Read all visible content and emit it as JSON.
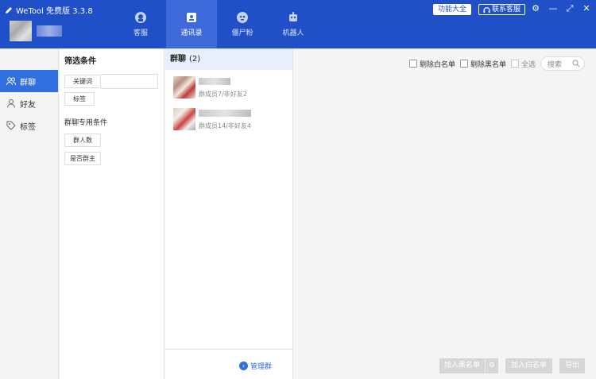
{
  "header": {
    "app_title": "WeTool 免费版 3.3.8",
    "nav": [
      {
        "label": "客服",
        "icon": "headset-icon",
        "active": false
      },
      {
        "label": "通讯录",
        "icon": "contacts-icon",
        "active": true
      },
      {
        "label": "僵尸粉",
        "icon": "zombie-icon",
        "active": false
      },
      {
        "label": "机器人",
        "icon": "robot-icon",
        "active": false
      }
    ],
    "features_label": "功能大全",
    "contact_label": "联系客服",
    "colors": {
      "primary": "#1f50c8",
      "active_tab": "#3e6ad9"
    }
  },
  "sidebar": {
    "items": [
      {
        "label": "群聊",
        "icon": "group-icon",
        "active": true
      },
      {
        "label": "好友",
        "icon": "person-icon",
        "active": false
      },
      {
        "label": "标签",
        "icon": "tag-icon",
        "active": false
      }
    ]
  },
  "filter": {
    "title": "筛选条件",
    "keyword_label": "关键词",
    "tag_label": "标签",
    "group_section_title": "群聊专用条件",
    "member_count_label": "群人数",
    "is_owner_label": "是否群主"
  },
  "group_list": {
    "title": "群聊",
    "count": "(2)",
    "items": [
      {
        "meta": "群成员7/非好友2"
      },
      {
        "meta": "群成员14/非好友4"
      }
    ],
    "manage_label": "管理群"
  },
  "right_panel": {
    "remove_whitelist": "剔除白名单",
    "remove_blacklist": "剔除黑名单",
    "select_all": "全选",
    "search_placeholder": "搜索",
    "add_blacklist": "加入黑名单",
    "add_whitelist": "加入白名单",
    "export": "导出"
  }
}
